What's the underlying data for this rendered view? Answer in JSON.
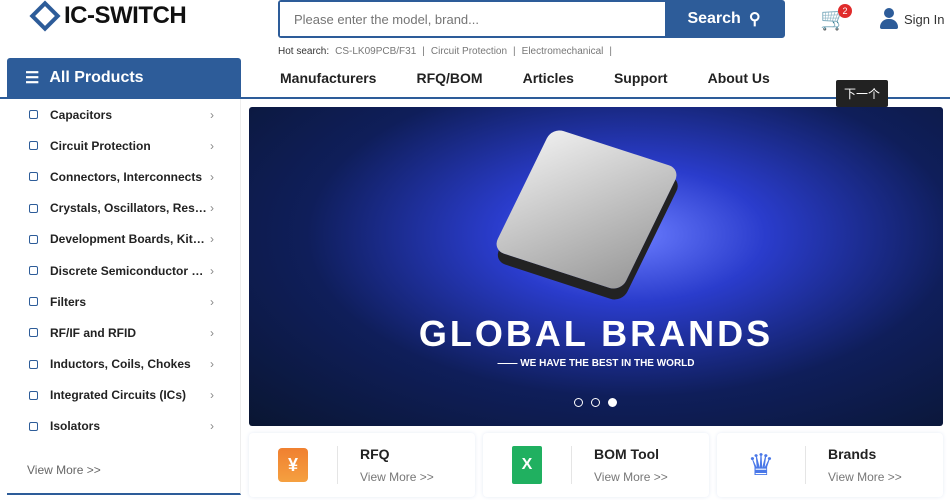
{
  "header": {
    "logo": "IC-SWITCH",
    "search_placeholder": "Please enter the model, brand...",
    "search_button": "Search",
    "cart_count": "2",
    "sign_in": "Sign In"
  },
  "hot_search": {
    "label": "Hot search:",
    "items": [
      "CS-LK09PCB/F31",
      "Circuit Protection",
      "Electromechanical"
    ]
  },
  "all_products": "All Products",
  "nav": [
    "Manufacturers",
    "RFQ/BOM",
    "Articles",
    "Support",
    "About Us"
  ],
  "tooltip": "下一个",
  "categories": [
    "Capacitors",
    "Circuit Protection",
    "Connectors, Interconnects",
    "Crystals, Oscillators, Resonators",
    "Development Boards, Kits, Programmers",
    "Discrete Semiconductor Products",
    "Filters",
    "RF/IF and RFID",
    "Inductors, Coils, Chokes",
    "Integrated Circuits (ICs)",
    "Isolators"
  ],
  "view_more": "View More >>",
  "banner": {
    "title": "GLOBAL  BRANDS",
    "subtitle": "—— WE HAVE THE BEST IN THE WORLD",
    "slides": 3,
    "active_slide": 3
  },
  "cards": [
    {
      "title": "RFQ",
      "link": "View More >>",
      "icon": "yen-chat-icon"
    },
    {
      "title": "BOM Tool",
      "link": "View More >>",
      "icon": "excel-icon"
    },
    {
      "title": "Brands",
      "link": "View More >>",
      "icon": "crown-icon"
    }
  ]
}
